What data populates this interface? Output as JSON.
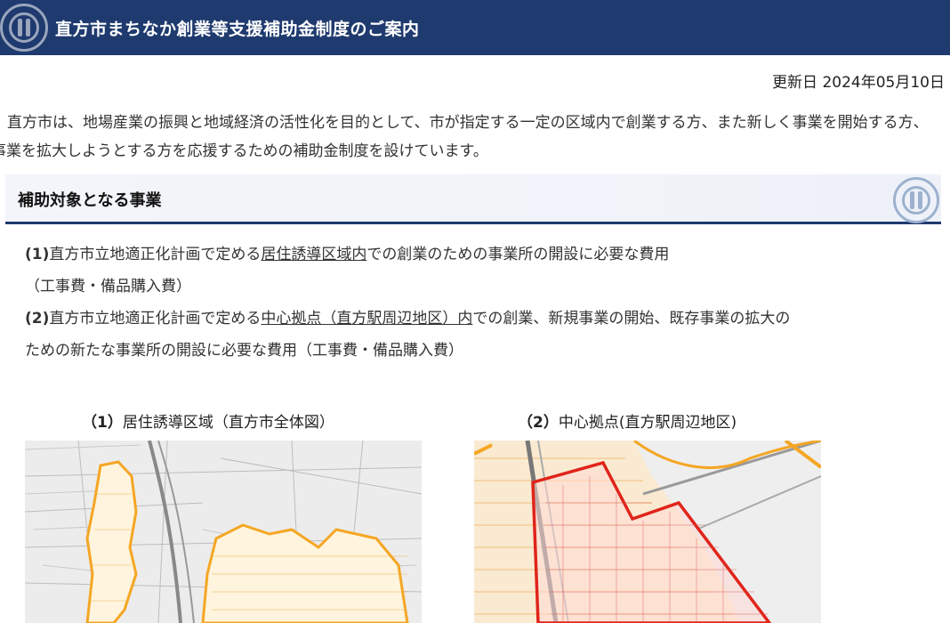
{
  "header": {
    "title": "直方市まちなか創業等支援補助金制度のご案内"
  },
  "updated": "更新日 2024年05月10日",
  "intro": "直方市は、地場産業の振興と地域経済の活性化を目的として、市が指定する一定の区域内で創業する方、また新しく事業を開始する方、事業を拡大しようとする方を応援するための補助金制度を設けています。",
  "section": {
    "title": "補助対象となる事業"
  },
  "items": [
    {
      "num": "(1)",
      "pre": "直方市立地適正化計画で定める",
      "link": "居住誘導区域内",
      "post": "での創業のための事業所の開設に必要な費用",
      "cont": "（工事費・備品購入費）"
    },
    {
      "num": "(2)",
      "pre": "直方市立地適正化計画で定める",
      "link": "中心拠点（直方駅周辺地区）内",
      "post": "での創業、新規事業の開始、既存事業の拡大の",
      "cont": "ための新たな事業所の開設に必要な費用（工事費・備品購入費）"
    }
  ],
  "maps": [
    {
      "num": "（1）",
      "caption": "居住誘導区域（直方市全体図）"
    },
    {
      "num": "（2）",
      "caption": "中心拠点(直方駅周辺地区)"
    }
  ],
  "colors": {
    "header_bg": "#1f3a6e",
    "zone_orange": "#f5a623",
    "zone_red": "#e0241b"
  }
}
